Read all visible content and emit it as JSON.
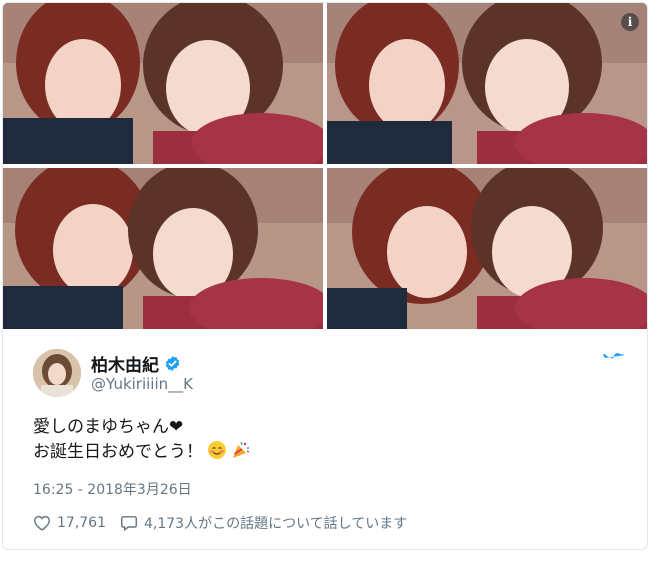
{
  "tweet": {
    "display_name": "柏木由紀",
    "handle": "@Yukiriiiin__K",
    "text_line1": "愛しのまゆちゃん",
    "text_line2": "お誕生日おめでとう！",
    "timestamp": "16:25 - 2018年3月26日",
    "likes": "17,761",
    "replies": "4,173人がこの話題について話しています"
  },
  "icons": {
    "info": "info-icon",
    "verified": "verified-badge-icon",
    "bird": "twitter-bird-icon",
    "heart": "heart-icon",
    "reply": "speech-bubble-icon",
    "emoji_smile": "smiling-blushing-face-emoji",
    "emoji_party": "party-popper-emoji",
    "heart_glyph": "black-heart-glyph"
  },
  "colors": {
    "brand_blue": "#1da1f2",
    "text_primary": "#14171a",
    "text_secondary": "#657786",
    "border": "#e1e8ed"
  }
}
